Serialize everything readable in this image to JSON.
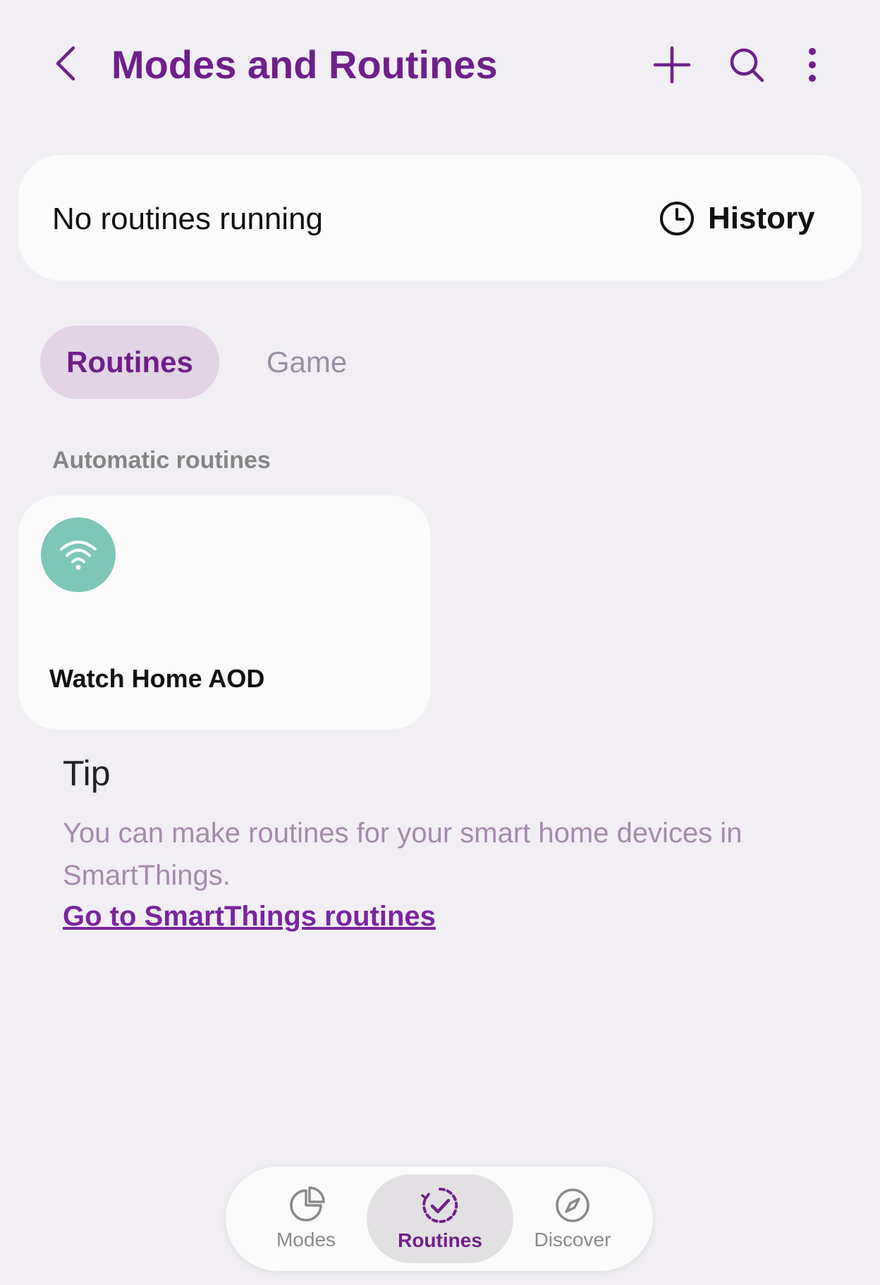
{
  "header": {
    "title": "Modes and Routines",
    "icons": [
      "back-arrow-icon",
      "plus-icon",
      "search-icon",
      "more-vertical-icon"
    ]
  },
  "status": {
    "text": "No routines running",
    "history_label": "History",
    "history_icon": "clock-icon"
  },
  "tabs": [
    {
      "label": "Routines",
      "active": true
    },
    {
      "label": "Game",
      "active": false
    }
  ],
  "automatic": {
    "section_label": "Automatic routines",
    "routines": [
      {
        "name": "Watch Home AOD",
        "icon": "wifi-icon",
        "icon_color": "#7ec6b7"
      }
    ]
  },
  "tip": {
    "title": "Tip",
    "body": "You can make routines for your smart home devices in SmartThings.",
    "link": "Go to SmartThings routines"
  },
  "bottom_nav": [
    {
      "label": "Modes",
      "icon": "modes-icon",
      "active": false
    },
    {
      "label": "Routines",
      "icon": "routines-icon",
      "active": true
    },
    {
      "label": "Discover",
      "icon": "compass-icon",
      "active": false
    }
  ],
  "colors": {
    "accent": "#6f1f8a",
    "background": "#f1eff4",
    "card": "#fbfbfb",
    "tab_active_bg": "#e2d4e5",
    "tip_text": "#a58aab",
    "link": "#7a25a0"
  }
}
